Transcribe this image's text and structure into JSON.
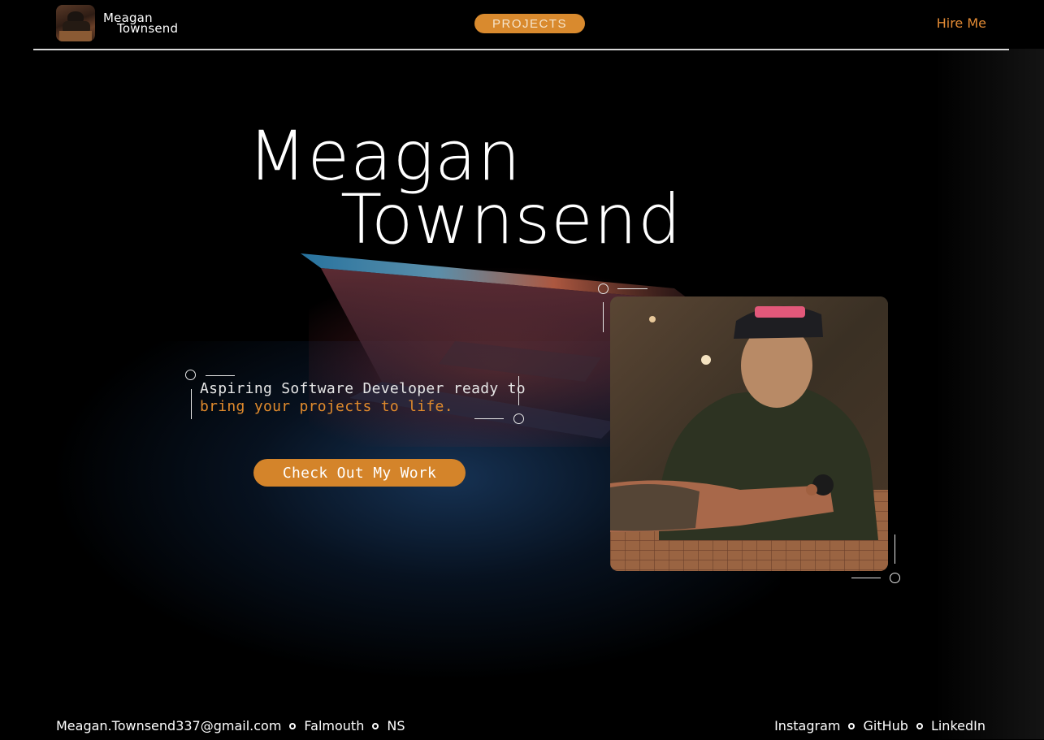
{
  "brand": {
    "first_name": "Meagan",
    "last_name": "Townsend",
    "avatar_icon": "profile-photo"
  },
  "nav": {
    "projects_label": "PROJECTS",
    "hire_label": "Hire Me"
  },
  "hero": {
    "title_line1": "Meagan",
    "title_line2": "Townsend",
    "tagline_line1": "Aspiring Software Developer ready to",
    "tagline_line2": "bring your projects to life.",
    "cta_label": "Check Out My Work"
  },
  "footer": {
    "email": "Meagan.Townsend337@gmail.com",
    "city": "Falmouth",
    "province": "NS",
    "social": [
      "Instagram",
      "GitHub",
      "LinkedIn"
    ]
  },
  "colors": {
    "accent": "#d98a2e",
    "accent_text": "#e08a2c",
    "background": "#000000",
    "text": "#ffffff"
  }
}
